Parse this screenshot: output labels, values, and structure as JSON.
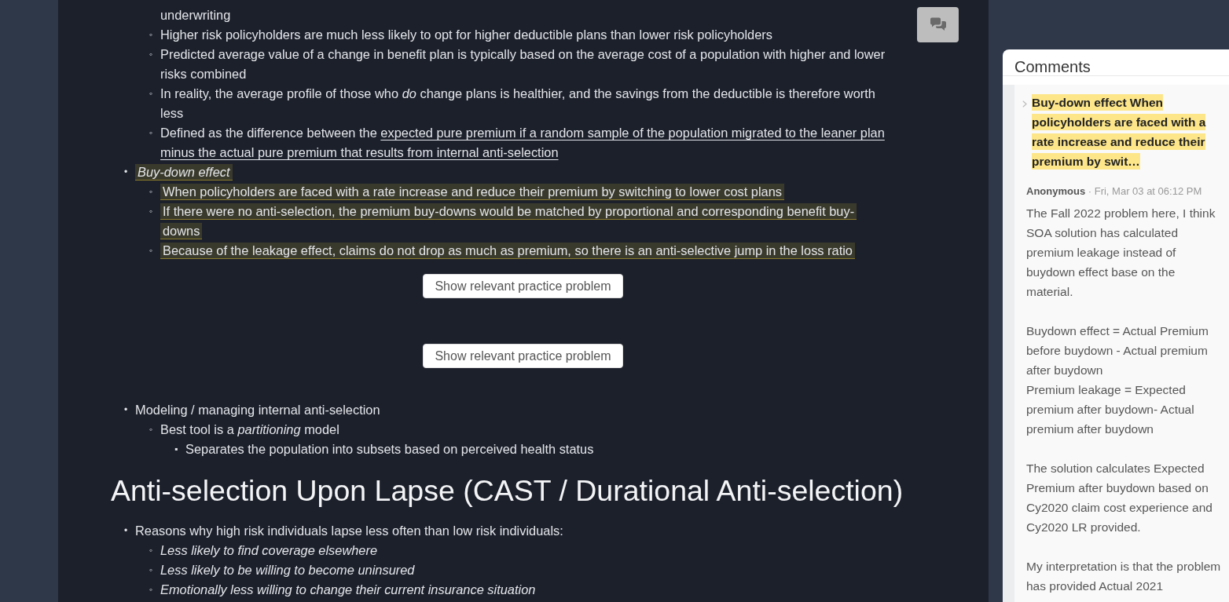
{
  "main": {
    "outline": [
      {
        "children": [
          {
            "text": "underwriting",
            "highlighted": false,
            "italic": false
          },
          {
            "marker": "◦",
            "text": "Higher risk policyholders are much less likely to opt for higher deductible plans than lower risk policyholders",
            "highlighted": false,
            "italic": false
          },
          {
            "marker": "◦",
            "text": "Predicted average value of a change in benefit plan is typically based on the average cost of a population with higher and lower risks combined",
            "highlighted": false,
            "italic": false
          },
          {
            "marker": "◦",
            "text": "In reality, the average profile of those who *do* change plans is healthier, and the savings from the deductible is therefore worth less",
            "highlighted": false,
            "italic": false
          },
          {
            "marker": "◦",
            "segments": [
              {
                "text": "Defined as the difference between the ",
                "underlined": false
              },
              {
                "text": "expected pure premium if a random sample of the population migrated to the leaner plan minus the actual pure premium that results from internal anti-selection",
                "underlined": true
              }
            ],
            "highlighted": false,
            "italic": false
          }
        ]
      },
      {
        "marker": "•",
        "text": "Buy-down effect",
        "highlighted": true,
        "italic": true,
        "children": [
          {
            "marker": "◦",
            "text": "When policyholders are faced with a rate increase and reduce their premium by switching to lower cost plans",
            "highlighted": true,
            "italic": false
          },
          {
            "marker": "◦",
            "text": "If there were no anti-selection, the premium buy-downs would be matched by proportional and corresponding benefit buy-downs",
            "highlighted": true,
            "italic": false
          },
          {
            "marker": "◦",
            "text": "Because of the leakage effect, claims do not drop as much as premium, so there is an anti-selective jump in the loss ratio",
            "highlighted": true,
            "italic": false
          }
        ]
      }
    ],
    "practice_buttons": [
      {
        "label": "Show relevant practice problem"
      },
      {
        "label": "Show relevant practice problem"
      }
    ],
    "outline_2": [
      {
        "marker": "•",
        "text": "Modeling / managing internal anti-selection",
        "highlighted": false,
        "italic": false,
        "children": [
          {
            "marker": "◦",
            "text": "Best tool is a *partitioning* model",
            "highlighted": false,
            "italic": false,
            "children": [
              {
                "marker": "▪",
                "text": "Separates the population into subsets based on perceived health status",
                "highlighted": false,
                "italic": false
              }
            ]
          }
        ]
      }
    ],
    "heading": "Anti-selection Upon Lapse (CAST / Durational Anti-selection)",
    "outline_3": [
      {
        "marker": "•",
        "text": "Reasons why high risk individuals lapse less often than low risk individuals:",
        "highlighted": false,
        "italic": false,
        "children": [
          {
            "marker": "◦",
            "text": "Less likely to find coverage elsewhere",
            "highlighted": false,
            "italic": true
          },
          {
            "marker": "◦",
            "text": "Less likely to be willing to become uninsured",
            "highlighted": false,
            "italic": true
          },
          {
            "marker": "◦",
            "text": "Emotionally less willing to change their current insurance situation",
            "highlighted": false,
            "italic": true
          }
        ]
      }
    ]
  },
  "comments": {
    "title": "Comments",
    "quote": "Buy-down effect When policyholders are faced with a rate increase and reduce their premium by swit…",
    "thread": [
      {
        "author": "Anonymous",
        "time": "· Fri, Mar 03 at 06:12 PM",
        "blocks": [
          {
            "lines": [
              "The Fall 2022 problem here, I think SOA solution has calculated premium leakage instead of buydown effect base on the material."
            ]
          },
          {
            "lines": [
              "Buydown effect = Actual Premium before buydown - Actual premium after buydown",
              "Premium leakage = Expected premium after buydown- Actual premium after buydown"
            ]
          },
          {
            "lines": [
              "The solution calculates Expected Premium after buydown based on Cy2020 claim cost experience and Cy2020 LR provided."
            ]
          },
          {
            "lines": [
              "My interpretation is that the problem has provided Actual 2021"
            ]
          }
        ]
      }
    ]
  }
}
